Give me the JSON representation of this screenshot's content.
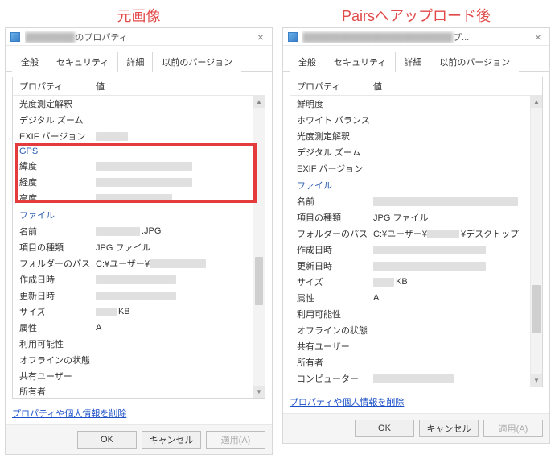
{
  "labels": {
    "left_title": "元画像",
    "right_title": "Pairsへアップロード後",
    "window_suffix_left": "のプロパティ",
    "window_suffix_right": "プ...",
    "tab_general": "全般",
    "tab_security": "セキュリティ",
    "tab_details": "詳細",
    "tab_prev": "以前のバージョン",
    "col_prop": "プロパティ",
    "col_val": "値",
    "link": "プロパティや個人情報を削除",
    "ok": "OK",
    "cancel": "キャンセル",
    "apply": "適用(A)"
  },
  "left": {
    "rows_top": [
      {
        "k": "光度測定解釈",
        "v": ""
      },
      {
        "k": "デジタル ズーム",
        "v": ""
      },
      {
        "k": "EXIF バージョン",
        "v": "",
        "blur": 40
      }
    ],
    "section_gps": "GPS",
    "rows_gps": [
      {
        "k": "緯度",
        "blur": 120
      },
      {
        "k": "経度",
        "blur": 120
      },
      {
        "k": "高度",
        "blur": 95
      }
    ],
    "section_file": "ファイル",
    "rows_file": [
      {
        "k": "名前",
        "v_suffix": ".JPG",
        "blur": 55
      },
      {
        "k": "項目の種類",
        "v": "JPG ファイル"
      },
      {
        "k": "フォルダーのパス",
        "v_prefix": "C:¥ユーザー¥",
        "blur": 70
      },
      {
        "k": "作成日時",
        "blur": 100
      },
      {
        "k": "更新日時",
        "blur": 100
      },
      {
        "k": "サイズ",
        "v_suffix": "KB",
        "blur": 26
      },
      {
        "k": "属性",
        "v": "A"
      },
      {
        "k": "利用可能性",
        "v": ""
      },
      {
        "k": "オフラインの状態",
        "v": ""
      },
      {
        "k": "共有ユーザー",
        "v": ""
      },
      {
        "k": "所有者",
        "v": "",
        "cut": true
      }
    ]
  },
  "right": {
    "rows_top": [
      {
        "k": "鮮明度",
        "v": ""
      },
      {
        "k": "ホワイト バランス",
        "v": ""
      },
      {
        "k": "光度測定解釈",
        "v": ""
      },
      {
        "k": "デジタル ズーム",
        "v": ""
      },
      {
        "k": "EXIF バージョン",
        "v": ""
      }
    ],
    "section_file": "ファイル",
    "rows_file": [
      {
        "k": "名前",
        "blur": 180
      },
      {
        "k": "項目の種類",
        "v": "JPG ファイル"
      },
      {
        "k": "フォルダーのパス",
        "v_prefix": "C:¥ユーザー¥",
        "v_suffix": "¥デスクトップ",
        "blur": 40
      },
      {
        "k": "作成日時",
        "blur": 140
      },
      {
        "k": "更新日時",
        "blur": 140
      },
      {
        "k": "サイズ",
        "v_suffix": "KB",
        "blur": 26
      },
      {
        "k": "属性",
        "v": "A"
      },
      {
        "k": "利用可能性",
        "v": ""
      },
      {
        "k": "オフラインの状態",
        "v": ""
      },
      {
        "k": "共有ユーザー",
        "v": ""
      },
      {
        "k": "所有者",
        "v": ""
      },
      {
        "k": "コンピューター",
        "blur": 100
      }
    ]
  }
}
